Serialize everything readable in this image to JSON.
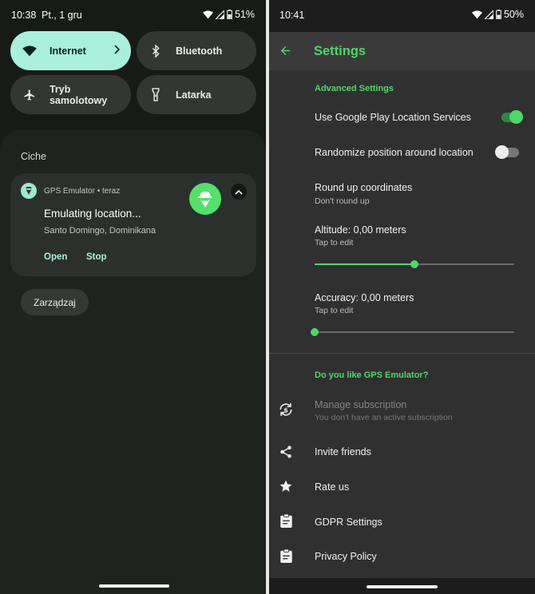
{
  "left": {
    "status": {
      "time": "10:38",
      "date": "Pt., 1 gru",
      "battery": "51%"
    },
    "tiles": [
      {
        "label": "Internet",
        "icon": "wifi-icon",
        "active": true
      },
      {
        "label": "Bluetooth",
        "icon": "bluetooth-icon",
        "active": false
      },
      {
        "label": "Tryb samolotowy",
        "icon": "airplane-icon",
        "active": false
      },
      {
        "label": "Latarka",
        "icon": "flashlight-icon",
        "active": false
      }
    ],
    "section_label": "Ciche",
    "notification": {
      "app_line": "GPS Emulator • teraz",
      "title": "Emulating location...",
      "subtitle": "Santo Domingo, Dominikana",
      "actions": [
        "Open",
        "Stop"
      ]
    },
    "manage_label": "Zarządzaj"
  },
  "right": {
    "status": {
      "time": "10:41",
      "battery": "50%"
    },
    "appbar_title": "Settings",
    "categories": {
      "advanced": "Advanced Settings",
      "feedback": "Do you like GPS Emulator?"
    },
    "prefs": {
      "google_play": {
        "title": "Use Google Play Location Services",
        "enabled": true
      },
      "randomize": {
        "title": "Randomize position around location",
        "enabled": false
      },
      "round_up": {
        "title": "Round up coordinates",
        "summary": "Don't round up"
      },
      "altitude": {
        "title": "Altitude: 0,00 meters",
        "summary": "Tap to edit",
        "slider_fraction": 0.5
      },
      "accuracy": {
        "title": "Accuracy: 0,00 meters",
        "summary": "Tap to edit",
        "slider_fraction": 0.0
      },
      "subscription": {
        "title": "Manage subscription",
        "summary": "You don't have an active subscription"
      },
      "invite": {
        "title": "Invite friends"
      },
      "rate": {
        "title": "Rate us"
      },
      "gdpr": {
        "title": "GDPR Settings"
      },
      "privacy": {
        "title": "Privacy Policy"
      }
    }
  },
  "colors": {
    "accent_green": "#4cd964",
    "tile_active": "#a8f0dc"
  }
}
